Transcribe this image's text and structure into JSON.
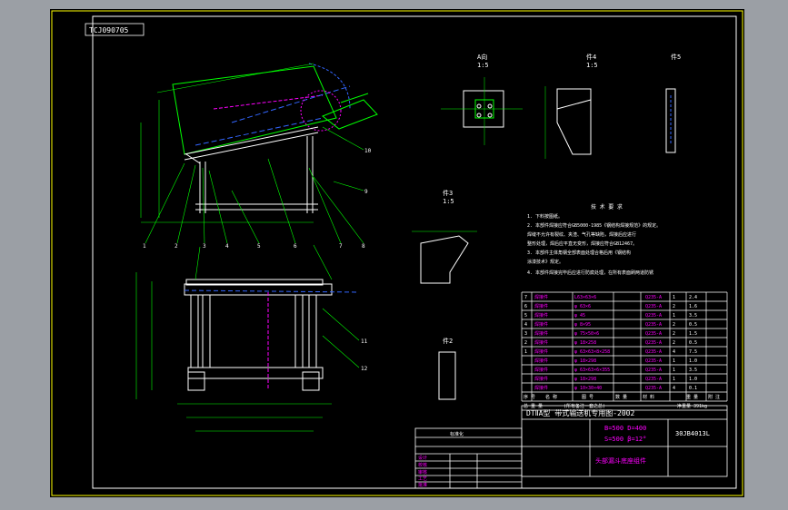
{
  "drawing": {
    "drawing_no": "TCJ090705",
    "view_labels": {
      "view_a": "A向",
      "view_a_scale": "1:5",
      "part4": "件4",
      "part4_scale": "1:5",
      "part5": "件5",
      "part3": "件3",
      "part3_scale": "1:5",
      "part2": "件2"
    },
    "tech_req_title": "技 术 要 求",
    "tech_requirements": [
      "1. 下料按图纸。",
      "2. 本部件焊接应符合GB5000-1985《钢结构焊接规范》的规定。",
      "   焊缝不允许有裂纹、夹渣、气孔等缺陷，焊接后应进行",
      "   整形处理，焊后应平直无变形，焊接应符合GB12467。",
      "3. 本部件主体角钢全部表面处理合格后用《钢结构",
      "   涂漆技术》规定。",
      "4. 本部件焊接完毕后应进行防腐处理，在所有表面刷两道防锈"
    ],
    "bom": {
      "rows": [
        {
          "no": "7",
          "name": "焊接件",
          "spec": "L63×63×6",
          "qty": "1",
          "mat": "Q235-A",
          "wt": "2.4"
        },
        {
          "no": "6",
          "name": "焊接件",
          "spec": "φ 63×6",
          "qty": "2",
          "mat": "Q235-A",
          "wt": "1.6"
        },
        {
          "no": "5",
          "name": "焊接件",
          "spec": "φ 45",
          "qty": "1",
          "mat": "Q235-A",
          "wt": "3.5"
        },
        {
          "no": "4",
          "name": "焊接件",
          "spec": "φ 8×95",
          "qty": "2",
          "mat": "Q235-A",
          "wt": "0.5"
        },
        {
          "no": "3",
          "name": "焊接件",
          "spec": "φ 75×50×6",
          "qty": "2",
          "mat": "Q235-A",
          "wt": "1.5"
        },
        {
          "no": "2",
          "name": "焊接件",
          "spec": "φ 18×258",
          "qty": "2",
          "mat": "Q235-A",
          "wt": "0.5"
        },
        {
          "no": "1",
          "name": "焊接件",
          "spec": "φ 63×63×8×258",
          "qty": "4",
          "mat": "Q235-A",
          "wt": "7.5"
        },
        {
          "no": "",
          "name": "焊接件",
          "spec": "φ 18×298",
          "qty": "1",
          "mat": "Q235-A",
          "wt": "1.0"
        },
        {
          "no": "",
          "name": "焊接件",
          "spec": "φ 63×63×6×355",
          "qty": "1",
          "mat": "Q235-A",
          "wt": "3.5"
        },
        {
          "no": "",
          "name": "焊接件",
          "spec": "φ 18×298",
          "qty": "1",
          "mat": "Q235-A",
          "wt": "1.0"
        },
        {
          "no": "",
          "name": "焊接件",
          "spec": "φ 10×30×40",
          "qty": "4",
          "mat": "Q235-A",
          "wt": "0.1"
        }
      ],
      "header": {
        "no": "序 号",
        "name": "名  称",
        "spec": "图 号",
        "qty": "数 量",
        "mat": "材 料",
        "wt": "重 量",
        "note": "附 注"
      },
      "total_left": "总 重 量",
      "total_mid": "(所有备注一套之总)",
      "total_right": "净重量  391kg"
    },
    "title_block": {
      "main_title": "DTⅡA型  带式输送机专用图-2002",
      "param1": "B=500 D=400",
      "param2": "S=500 β=12°",
      "code": "30JB4013L",
      "name": "头部漏斗底座组件",
      "left_head": "标准化",
      "left_rows": [
        "设计",
        "校核",
        "审核",
        "工艺",
        "批准",
        "日期"
      ]
    },
    "callouts": [
      "1",
      "2",
      "3",
      "4",
      "5",
      "6",
      "7",
      "8",
      "9",
      "10",
      "11",
      "12"
    ]
  }
}
